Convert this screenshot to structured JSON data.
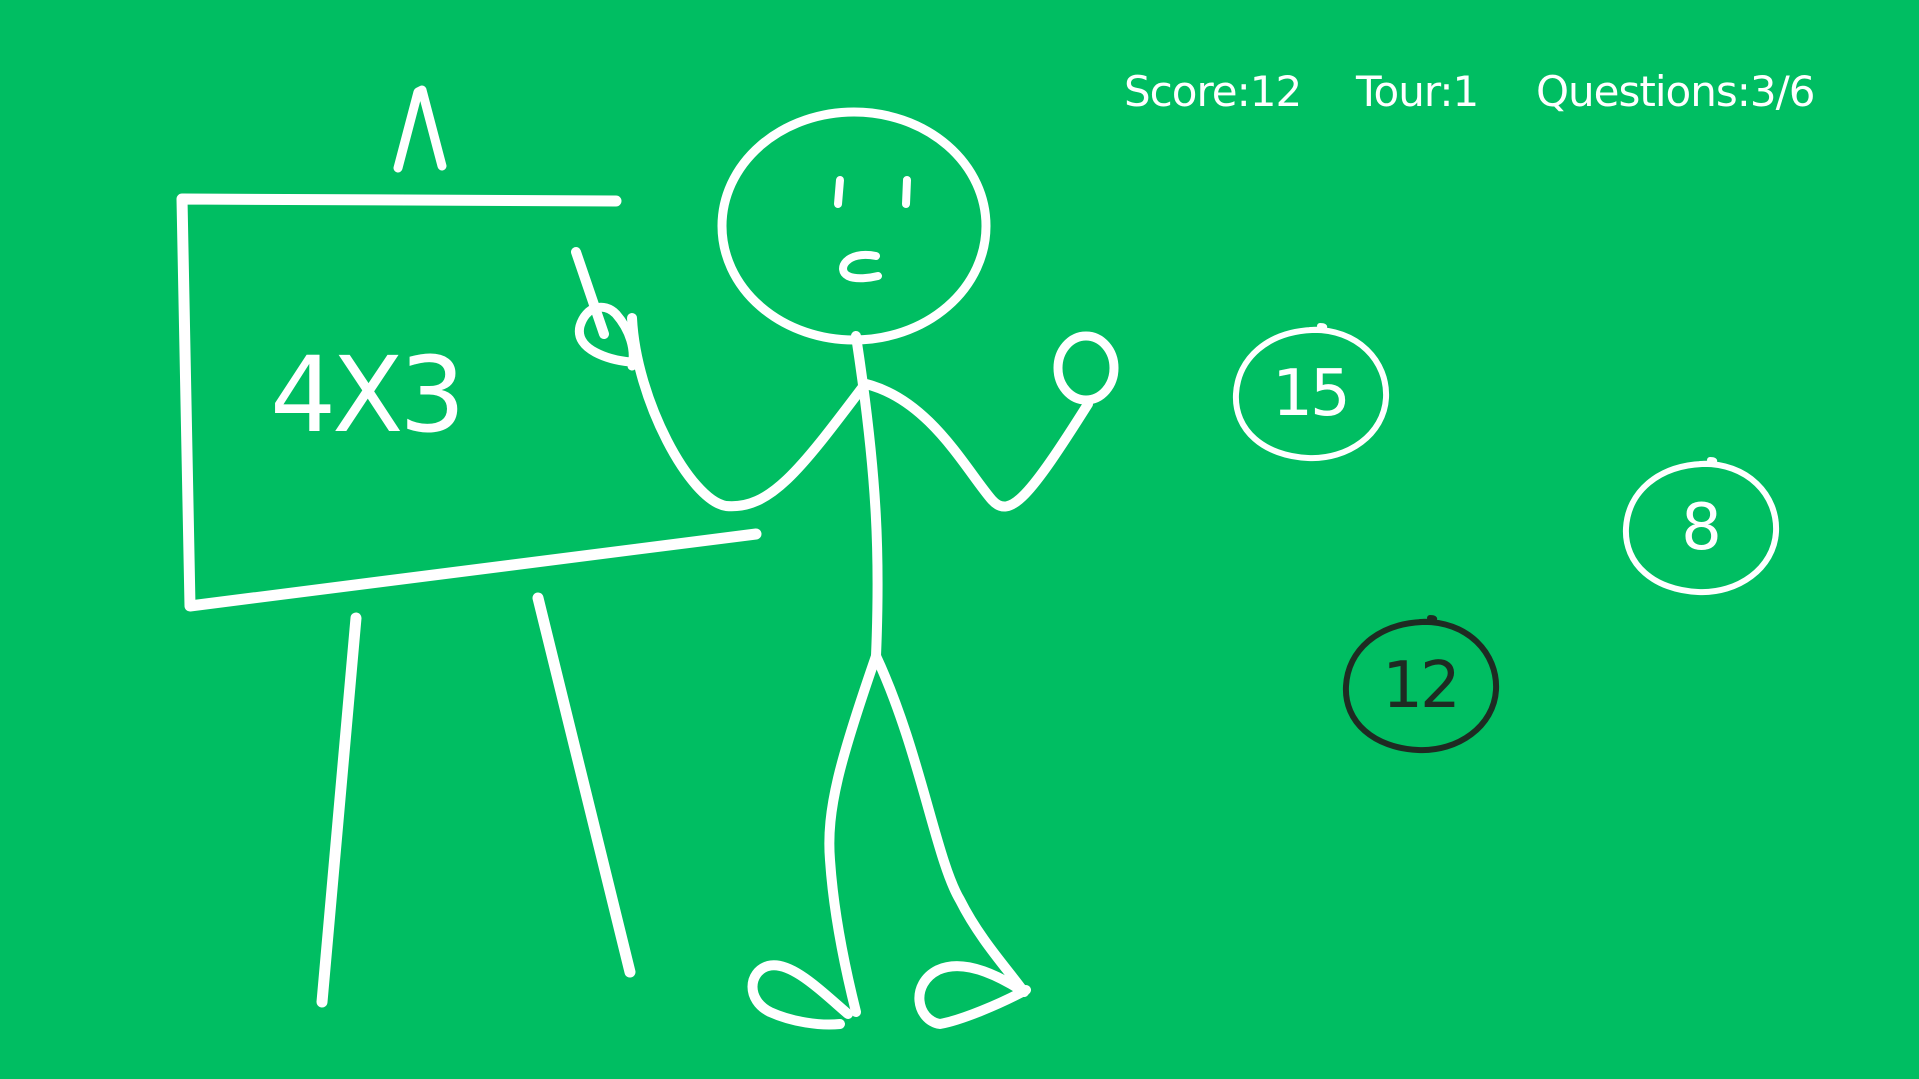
{
  "hud": {
    "score": "Score:12",
    "tour": "Tour:1",
    "questions": "Questions:3/6"
  },
  "board": {
    "question": "4X3"
  },
  "answers": [
    {
      "label": "15",
      "selected": false
    },
    {
      "label": "8",
      "selected": false
    },
    {
      "label": "12",
      "selected": true
    }
  ],
  "colors": {
    "background": "#00be62",
    "chalk": "#ffffff",
    "selected": "#1e2b22"
  }
}
